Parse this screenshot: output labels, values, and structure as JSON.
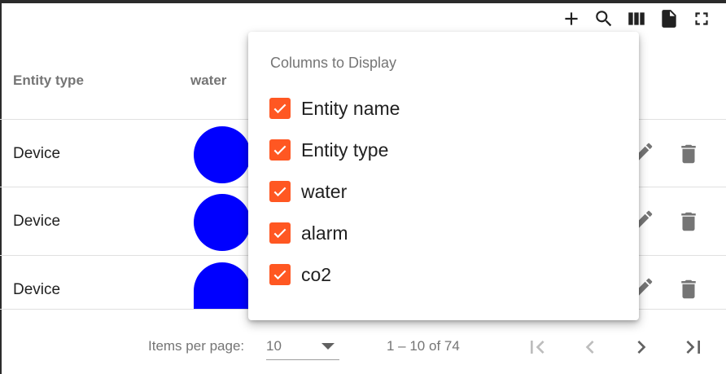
{
  "toolbar": {
    "icons": [
      "add-icon",
      "search-icon",
      "columns-icon",
      "export-file-icon",
      "fullscreen-icon"
    ]
  },
  "table": {
    "headers": {
      "entity_type": "Entity type",
      "water": "water"
    },
    "rows": [
      {
        "entity_type": "Device",
        "water_color": "#0000ff"
      },
      {
        "entity_type": "Device",
        "water_color": "#0000ff"
      },
      {
        "entity_type": "Device",
        "water_color": "#0000ff"
      }
    ],
    "row_icons": [
      "edit-icon",
      "delete-icon"
    ]
  },
  "columns_popup": {
    "title": "Columns to Display",
    "options": [
      {
        "label": "Entity name",
        "checked": true
      },
      {
        "label": "Entity type",
        "checked": true
      },
      {
        "label": "water",
        "checked": true
      },
      {
        "label": "alarm",
        "checked": true
      },
      {
        "label": "co2",
        "checked": true
      }
    ],
    "checkbox_color": "#ff5722"
  },
  "paginator": {
    "items_per_page_label": "Items per page:",
    "items_per_page_value": "10",
    "range_label": "1 – 10 of 74",
    "buttons": [
      "first-page-icon",
      "previous-page-icon",
      "next-page-icon",
      "last-page-icon"
    ]
  }
}
